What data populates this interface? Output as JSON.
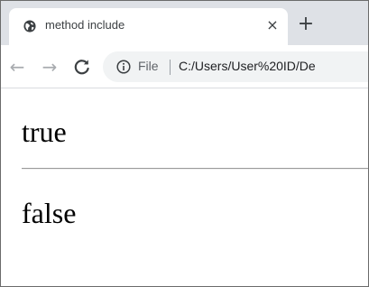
{
  "tab": {
    "title": "method include",
    "close_glyph": "×",
    "favicon": "globe-icon"
  },
  "tabstrip": {
    "new_tab_glyph": "+"
  },
  "toolbar": {
    "back_glyph": "←",
    "forward_glyph": "→",
    "reload_glyph": "C",
    "scheme_label": "File",
    "url": "C:/Users/User%20ID/De",
    "info_icon": "info-icon"
  },
  "page": {
    "line1": "true",
    "line2": "false"
  },
  "colors": {
    "tabstrip_bg": "#dee1e6",
    "omnibox_bg": "#f1f3f4",
    "text_dark": "#3c4043"
  }
}
